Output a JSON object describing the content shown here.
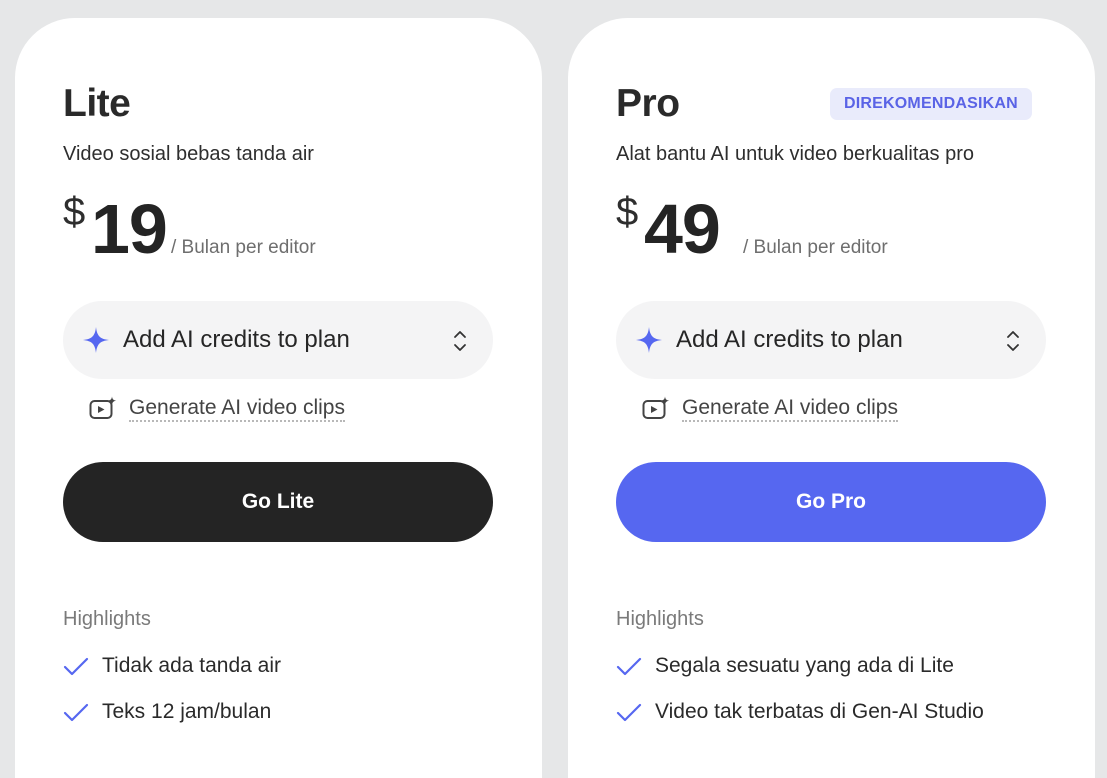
{
  "colors": {
    "page_background": "#e6e7e8",
    "card_background": "#ffffff",
    "accent": "#5667f0",
    "dark_button": "#242424",
    "badge_background": "#e9ebfb",
    "badge_text": "#5a63e6"
  },
  "plans": [
    {
      "name": "Lite",
      "badge": "",
      "subtitle": "Video sosial bebas tanda air",
      "currency": "$",
      "price": "19",
      "period": "/ Bulan per editor",
      "credits_select": {
        "icon": "sparkle-icon",
        "label": "Add AI credits to plan",
        "arrow_icon": "chevron-up-down-icon"
      },
      "generate_clips": {
        "icon": "ai-video-clip-icon",
        "label": "Generate AI video clips"
      },
      "cta_label": "Go Lite",
      "highlights_title": "Highlights",
      "features": [
        "Tidak ada tanda air",
        "Teks 12 jam/bulan"
      ]
    },
    {
      "name": "Pro",
      "badge": "DIREKOMENDASIKAN",
      "subtitle": "Alat bantu AI untuk video berkualitas pro",
      "currency": "$",
      "price": "49",
      "period": "/ Bulan per editor",
      "credits_select": {
        "icon": "sparkle-icon",
        "label": "Add AI credits to plan",
        "arrow_icon": "chevron-up-down-icon"
      },
      "generate_clips": {
        "icon": "ai-video-clip-icon",
        "label": "Generate AI video clips"
      },
      "cta_label": "Go Pro",
      "highlights_title": "Highlights",
      "features": [
        "Segala sesuatu yang ada di Lite",
        "Video tak terbatas di Gen-AI Studio"
      ]
    }
  ]
}
